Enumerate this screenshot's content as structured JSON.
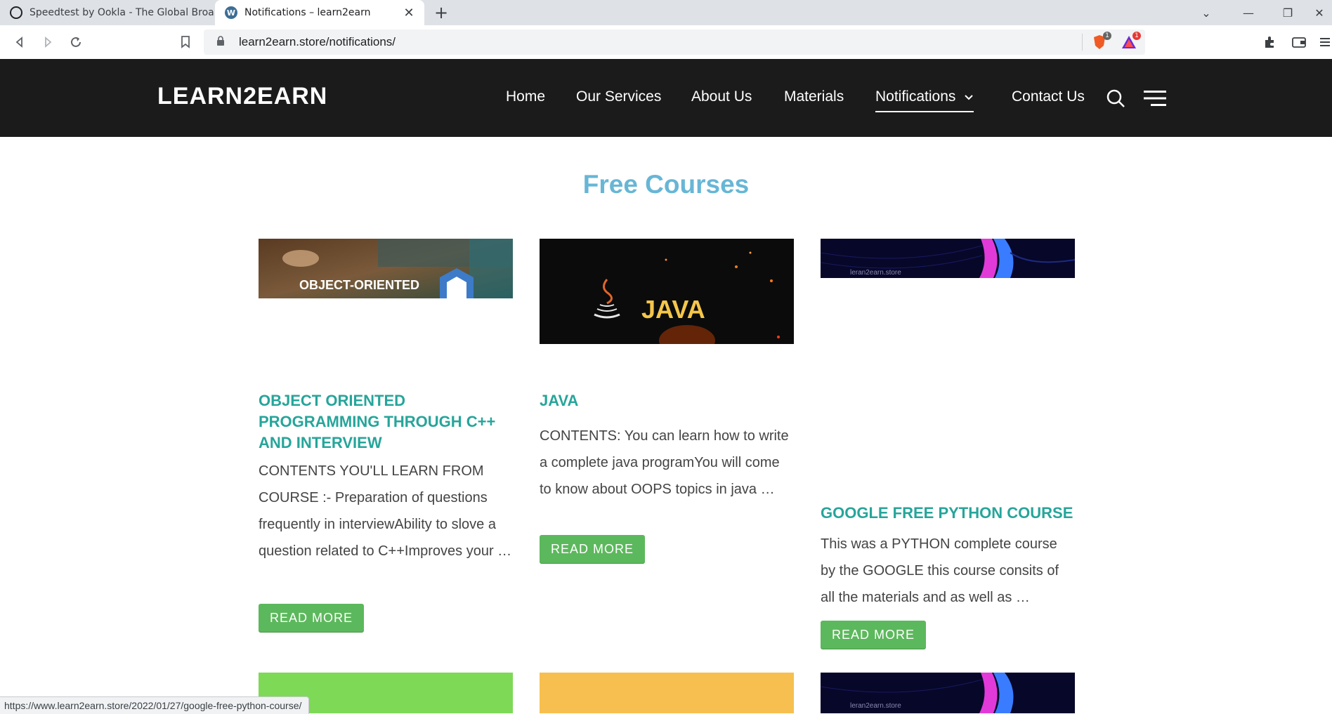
{
  "browser": {
    "tabs": [
      {
        "title": "Speedtest by Ookla - The Global Broadband Speed Test",
        "favicon": "speedtest-icon"
      },
      {
        "title": "Notifications – learn2earn",
        "favicon": "wordpress-icon"
      }
    ],
    "url": "learn2earn.store/notifications/",
    "brave_badge": "1",
    "rewards_badge": "1",
    "status_url": "https://www.learn2earn.store/2022/01/27/google-free-python-course/"
  },
  "site": {
    "logo": "LEARN2EARN",
    "nav": [
      {
        "label": "Home"
      },
      {
        "label": "Our Services"
      },
      {
        "label": "About Us"
      },
      {
        "label": "Materials"
      },
      {
        "label": "Notifications"
      },
      {
        "label": "Contact Us"
      }
    ]
  },
  "page": {
    "title": "Free Courses",
    "cards": [
      {
        "image_text": "OBJECT-ORIENTED",
        "title": "OBJECT ORIENTED PROGRAMMING THROUGH C++ AND INTERVIEW",
        "excerpt": "CONTENTS YOU'LL LEARN FROM COURSE :- Preparation of questions frequently in interviewAbility to slove a question related to C++Improves your …",
        "button": "READ MORE"
      },
      {
        "image_text": "JAVA",
        "title": "JAVA",
        "excerpt": "CONTENTS: You can learn how to write a complete java programYou will come to know about OOPS topics in java …",
        "button": "READ MORE"
      },
      {
        "image_text": "leran2earn.store",
        "title": "GOOGLE FREE PYTHON COURSE",
        "excerpt": "This was a PYTHON complete course by the GOOGLE this course consits of all the materials and as well as …",
        "button": "READ MORE"
      }
    ],
    "row2_image_text": "leran2earn.store"
  },
  "colors": {
    "header_bg": "#1b1b1b",
    "title": "#67b6d6",
    "card_title": "#26a59a",
    "button": "#5cb85c"
  }
}
